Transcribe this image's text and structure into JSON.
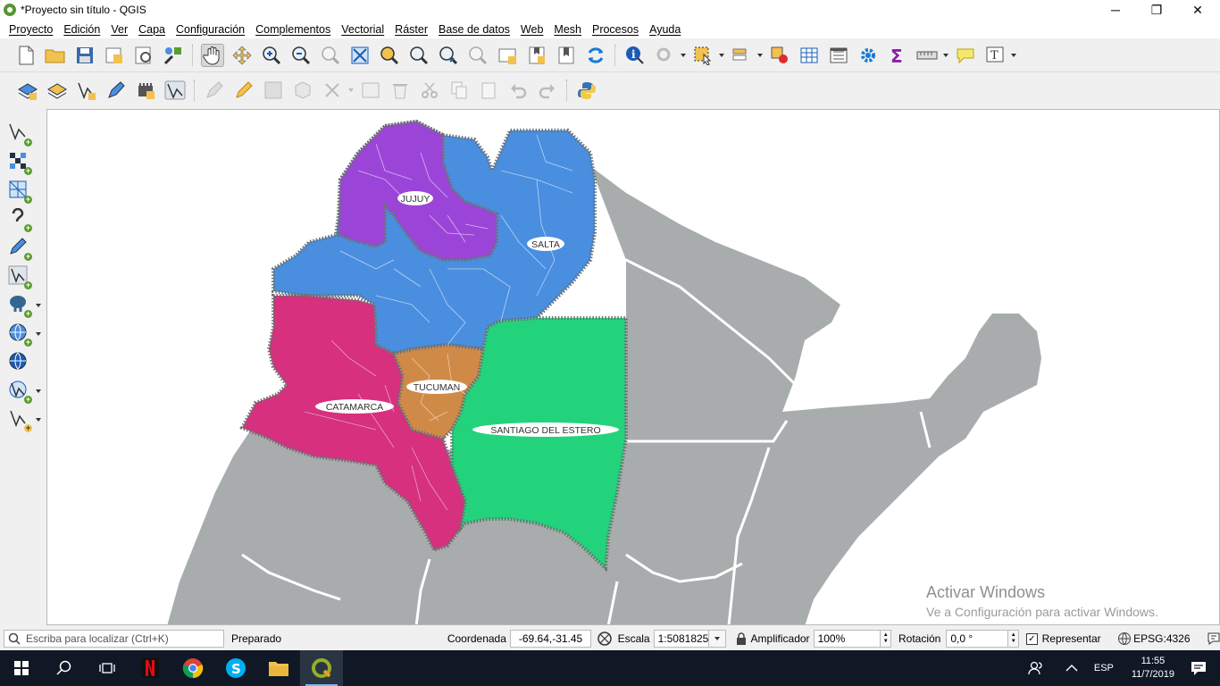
{
  "window": {
    "title": "*Proyecto sin título - QGIS",
    "controls": {
      "minimize": "─",
      "maximize": "❐",
      "close": "✕"
    }
  },
  "menu": [
    "Proyecto",
    "Edición",
    "Ver",
    "Capa",
    "Configuración",
    "Complementos",
    "Vectorial",
    "Ráster",
    "Base de datos",
    "Web",
    "Mesh",
    "Procesos",
    "Ayuda"
  ],
  "map": {
    "labels": {
      "jujuy": "JUJUY",
      "salta": "SALTA",
      "tucuman": "TUCUMAN",
      "catamarca": "CATAMARCA",
      "santiago": "SANTIAGO DEL ESTERO"
    },
    "colors": {
      "background_land": "#a8acad",
      "jujuy": "#9b45d8",
      "salta": "#4a8ee0",
      "tucuman": "#d08a48",
      "catamarca": "#d6307f",
      "santiago": "#23d37c",
      "outline": "#6b7170"
    }
  },
  "watermark": {
    "line1": "Activar Windows",
    "line2": "Ve a Configuración para activar Windows."
  },
  "status": {
    "locator_placeholder": "Escriba para localizar (Ctrl+K)",
    "message": "Preparado",
    "coord_label": "Coordenada",
    "coord_value": "-69.64,-31.45",
    "scale_label": "Escala",
    "scale_value": "1:5081825",
    "magnifier_label": "Amplificador",
    "magnifier_value": "100%",
    "rotation_label": "Rotación",
    "rotation_value": "0,0 °",
    "render_label": "Representar",
    "render_checked": true,
    "crs": "EPSG:4326"
  },
  "taskbar": {
    "lang": "ESP",
    "time": "11:55",
    "date": "11/7/2019"
  }
}
